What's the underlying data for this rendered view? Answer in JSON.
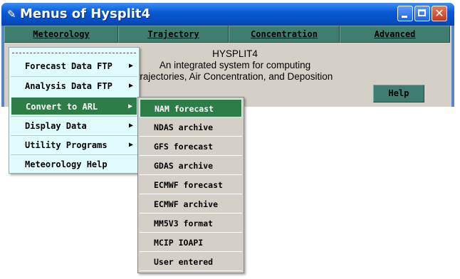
{
  "window": {
    "title": "Menus of Hysplit4",
    "icon": "feather-icon",
    "colors": {
      "titlebar": "#0a5ad6",
      "menu_green": "#3e7d70",
      "highlight": "#2d7d47",
      "menu_bg": "#e0fcfc"
    }
  },
  "menubar": {
    "items": [
      {
        "label": "Meteorology"
      },
      {
        "label": "Trajectory"
      },
      {
        "label": "Concentration"
      },
      {
        "label": "Advanced"
      }
    ]
  },
  "main": {
    "lines": [
      "HYSPLIT4",
      "An integrated system for computing",
      "trajectories, Air Concentration, and Deposition"
    ],
    "help_label": "Help"
  },
  "meteorology_menu": {
    "items": [
      {
        "label": "Forecast Data FTP",
        "submenu": true
      },
      {
        "label": "Analysis Data FTP",
        "submenu": true
      },
      {
        "label": "Convert to ARL",
        "submenu": true,
        "active": true
      },
      {
        "label": "Display Data",
        "submenu": true
      },
      {
        "label": "Utility Programs",
        "submenu": true
      },
      {
        "label": "Meteorology Help",
        "submenu": false
      }
    ]
  },
  "convert_submenu": {
    "items": [
      {
        "label": "NAM forecast",
        "active": true
      },
      {
        "label": "NDAS archive"
      },
      {
        "label": "GFS forecast"
      },
      {
        "label": "GDAS archive"
      },
      {
        "label": "ECMWF forecast"
      },
      {
        "label": "ECMWF archive"
      },
      {
        "label": "MM5V3 format"
      },
      {
        "label": "MCIP IOAPI"
      },
      {
        "label": "User entered"
      }
    ]
  }
}
